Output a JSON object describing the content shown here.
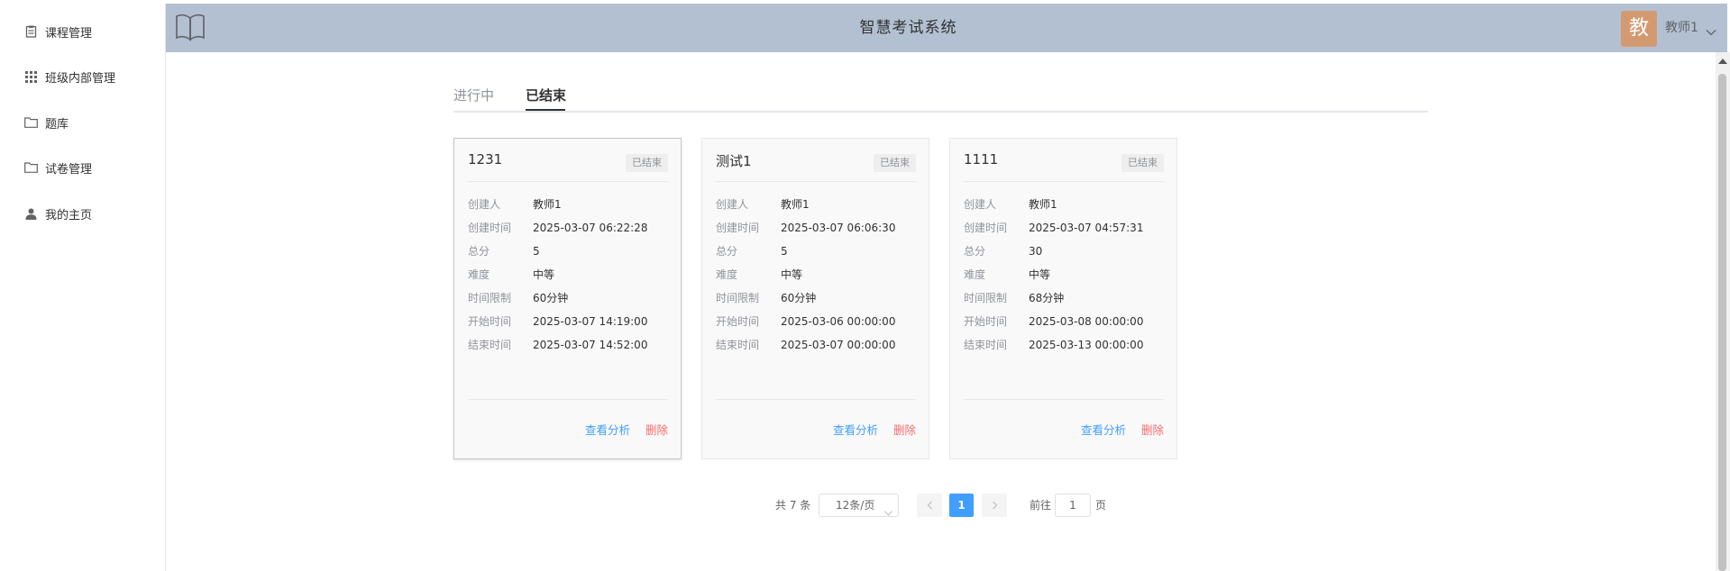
{
  "sidebar": {
    "items": [
      {
        "label": "课程管理",
        "icon": "document-icon"
      },
      {
        "label": "班级内部管理",
        "icon": "grid-icon"
      },
      {
        "label": "题库",
        "icon": "folder-icon"
      },
      {
        "label": "试卷管理",
        "icon": "folder-icon"
      },
      {
        "label": "我的主页",
        "icon": "user-icon"
      }
    ]
  },
  "header": {
    "title": "智慧考试系统",
    "avatar_text": "教",
    "user_name": "教师1",
    "logo_icon": "open-book-icon",
    "background": "#b3c0d1"
  },
  "tabs": [
    {
      "label": "进行中",
      "active": false
    },
    {
      "label": "已结束",
      "active": true
    }
  ],
  "cards": [
    {
      "title": "1231",
      "status": "已结束",
      "rows": [
        {
          "label": "创建人",
          "value": "教师1"
        },
        {
          "label": "创建时间",
          "value": "2025-03-07 06:22:28"
        },
        {
          "label": "总分",
          "value": "5"
        },
        {
          "label": "难度",
          "value": "中等"
        },
        {
          "label": "时间限制",
          "value": "60分钟"
        },
        {
          "label": "开始时间",
          "value": "2025-03-07 14:19:00"
        },
        {
          "label": "结束时间",
          "value": "2025-03-07 14:52:00"
        }
      ],
      "analyze_label": "查看分析",
      "delete_label": "删除"
    },
    {
      "title": "测试1",
      "status": "已结束",
      "rows": [
        {
          "label": "创建人",
          "value": "教师1"
        },
        {
          "label": "创建时间",
          "value": "2025-03-07 06:06:30"
        },
        {
          "label": "总分",
          "value": "5"
        },
        {
          "label": "难度",
          "value": "中等"
        },
        {
          "label": "时间限制",
          "value": "60分钟"
        },
        {
          "label": "开始时间",
          "value": "2025-03-06 00:00:00"
        },
        {
          "label": "结束时间",
          "value": "2025-03-07 00:00:00"
        }
      ],
      "analyze_label": "查看分析",
      "delete_label": "删除"
    },
    {
      "title": "1111",
      "status": "已结束",
      "rows": [
        {
          "label": "创建人",
          "value": "教师1"
        },
        {
          "label": "创建时间",
          "value": "2025-03-07 04:57:31"
        },
        {
          "label": "总分",
          "value": "30"
        },
        {
          "label": "难度",
          "value": "中等"
        },
        {
          "label": "时间限制",
          "value": "68分钟"
        },
        {
          "label": "开始时间",
          "value": "2025-03-08 00:00:00"
        },
        {
          "label": "结束时间",
          "value": "2025-03-13 00:00:00"
        }
      ],
      "analyze_label": "查看分析",
      "delete_label": "删除"
    }
  ],
  "pagination": {
    "total": "共 7 条",
    "page_size": "12条/页",
    "current_page": "1",
    "goto_label": "前往",
    "goto_value": "1",
    "page_unit": "页"
  },
  "colors": {
    "primary": "#409eff",
    "danger": "#f56c6c",
    "avatar": "#d39a72"
  }
}
